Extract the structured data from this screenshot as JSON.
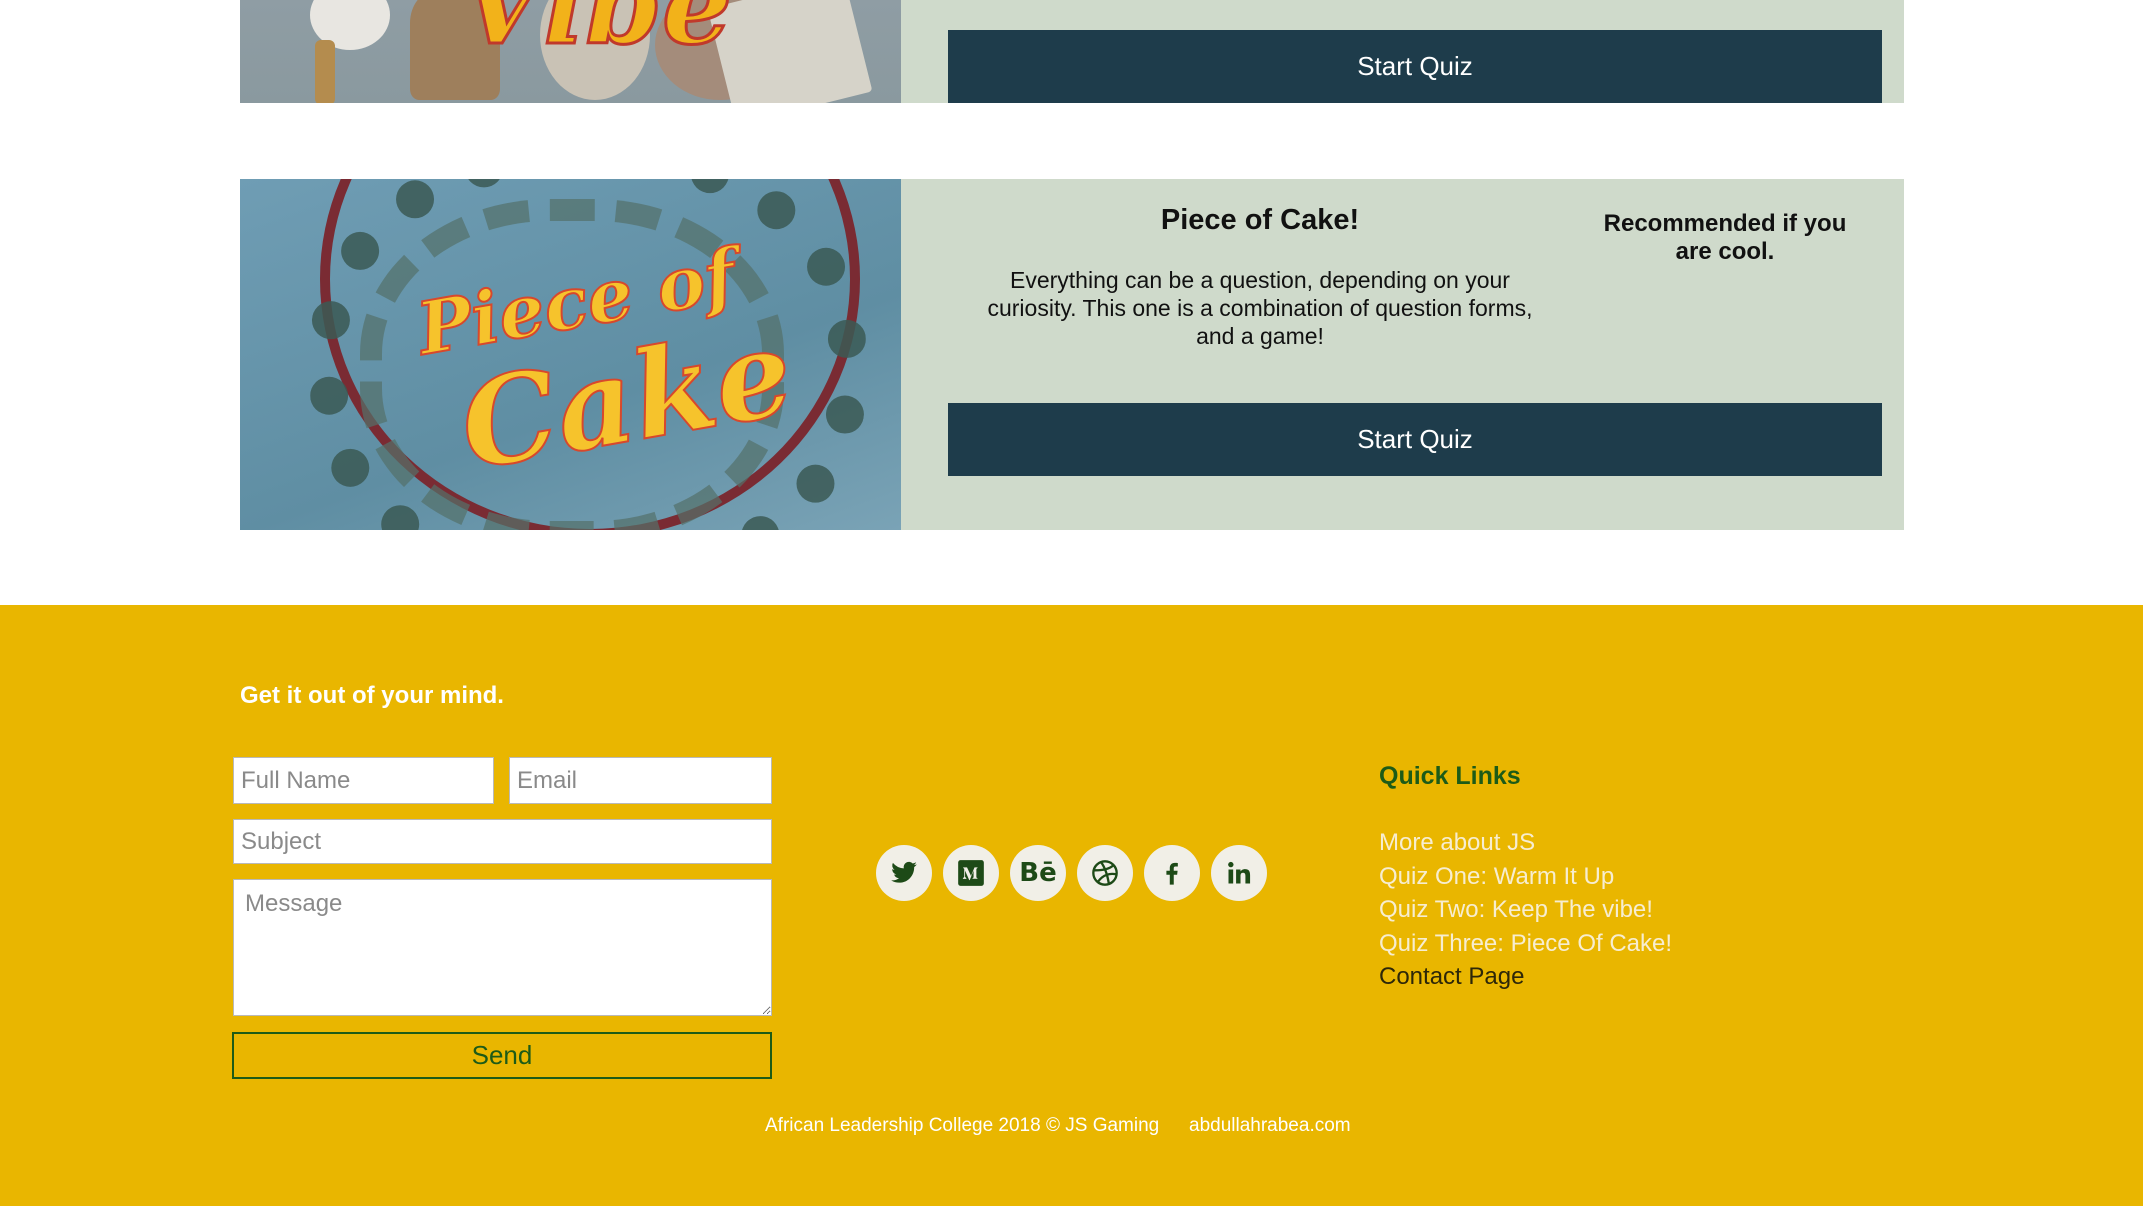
{
  "quizzes": [
    {
      "image_text": "Vibe",
      "start_label": "Start Quiz"
    },
    {
      "image_text_line1": "Piece of",
      "image_text_line2": "Cake",
      "title": "Piece of Cake!",
      "description": "Everything can be a question, depending on your curiosity. This one is a combination of question forms, and a game!",
      "recommendation": "Recommended if you are cool.",
      "start_label": "Start Quiz"
    }
  ],
  "footer": {
    "heading": "Get it out of your mind.",
    "form": {
      "full_name_placeholder": "Full Name",
      "email_placeholder": "Email",
      "subject_placeholder": "Subject",
      "message_placeholder": "Message",
      "send_label": "Send"
    },
    "social": [
      {
        "icon": "twitter-icon",
        "glyph": ""
      },
      {
        "icon": "medium-icon",
        "glyph": "M"
      },
      {
        "icon": "behance-icon",
        "glyph": "Bē"
      },
      {
        "icon": "dribbble-icon",
        "glyph": ""
      },
      {
        "icon": "facebook-icon",
        "glyph": "f"
      },
      {
        "icon": "linkedin-icon",
        "glyph": "in"
      }
    ],
    "quick_links": {
      "title": "Quick Links",
      "items": [
        "More about JS",
        "Quiz One: Warm It Up",
        "Quiz Two: Keep The vibe!",
        "Quiz Three: Piece Of Cake!",
        "Contact Page"
      ]
    },
    "copyright": "African Leadership College 2018 © JS Gaming",
    "site_link": "abdullahrabea.com"
  },
  "colors": {
    "card_bg": "#cfdacb",
    "button_bg": "#1e3c4b",
    "footer_bg": "#e9b600",
    "accent_green": "#1d5b17"
  }
}
